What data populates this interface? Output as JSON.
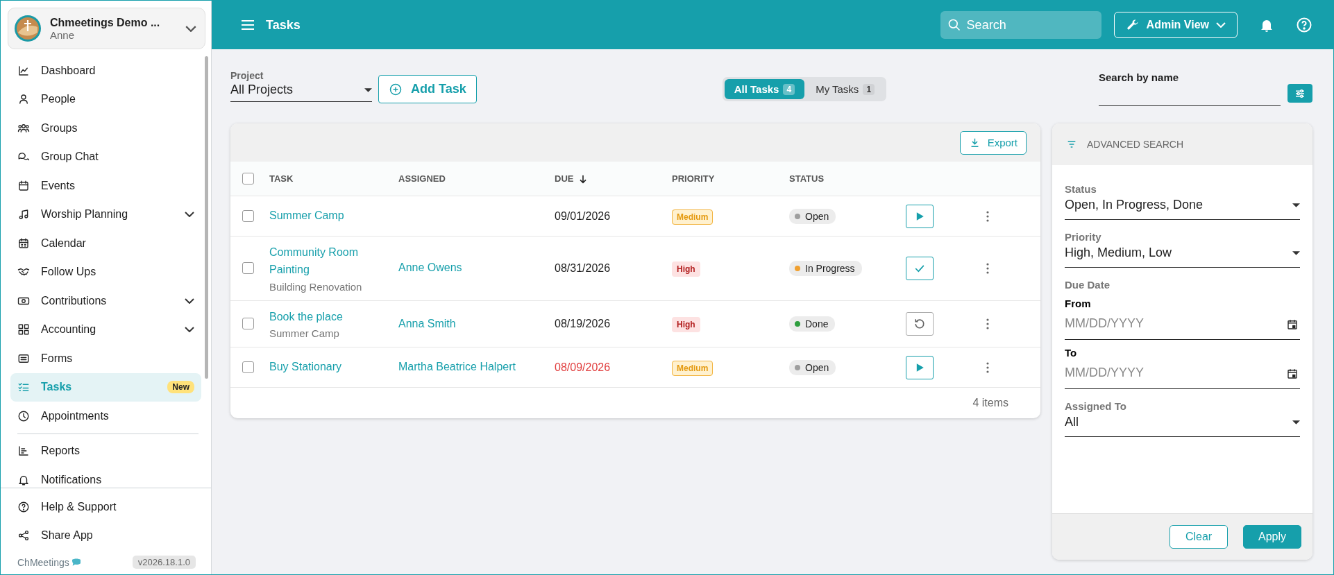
{
  "sidebar": {
    "account": {
      "name": "Chmeetings Demo ...",
      "user": "Anne"
    },
    "nav_sections": [
      {
        "items": [
          {
            "label": "Dashboard",
            "selected": false,
            "expandable": false
          },
          {
            "label": "People",
            "selected": false,
            "expandable": false
          },
          {
            "label": "Groups",
            "selected": false,
            "expandable": false
          },
          {
            "label": "Group Chat",
            "selected": false,
            "expandable": false
          },
          {
            "label": "Events",
            "selected": false,
            "expandable": false
          },
          {
            "label": "Worship Planning",
            "selected": false,
            "expandable": true
          },
          {
            "label": "Calendar",
            "selected": false,
            "expandable": false
          },
          {
            "label": "Follow Ups",
            "selected": false,
            "expandable": false
          },
          {
            "label": "Contributions",
            "selected": false,
            "expandable": true
          },
          {
            "label": "Accounting",
            "selected": false,
            "expandable": true
          },
          {
            "label": "Forms",
            "selected": false,
            "expandable": false
          },
          {
            "label": "Tasks",
            "selected": true,
            "expandable": false,
            "badge": "New"
          },
          {
            "label": "Appointments",
            "selected": false,
            "expandable": false
          }
        ]
      },
      {
        "items": [
          {
            "label": "Reports",
            "selected": false,
            "expandable": false
          },
          {
            "label": "Notifications",
            "selected": false,
            "expandable": false
          }
        ]
      }
    ],
    "bottom_items": [
      {
        "label": "Help & Support"
      },
      {
        "label": "Share App"
      }
    ],
    "brand": "ChMeetings",
    "version": "v2026.18.1.0"
  },
  "header": {
    "title": "Tasks",
    "search": {
      "placeholder": "Search"
    },
    "view_button": "Admin View"
  },
  "toolbar": {
    "project": {
      "label": "Project",
      "value": "All Projects"
    },
    "add_button": "Add Task",
    "tabs": [
      {
        "label": "All Tasks",
        "count": "4",
        "selected": true
      },
      {
        "label": "My Tasks",
        "count": "1",
        "selected": false
      }
    ],
    "name_search": {
      "label": "Search by name"
    }
  },
  "table": {
    "export_button": "Export",
    "select_all": {
      "checked": false
    },
    "columns": [
      {
        "label": "TASK",
        "sorted": false
      },
      {
        "label": "ASSIGNED",
        "sorted": false
      },
      {
        "label": "DUE",
        "sorted": true
      },
      {
        "label": "PRIORITY",
        "sorted": false
      },
      {
        "label": "STATUS",
        "sorted": false
      }
    ],
    "rows": [
      {
        "checked": false,
        "task": "Summer Camp",
        "due": "09/01/2026",
        "overdue": false,
        "priority": {
          "label": "Medium",
          "kind": "medium"
        },
        "status": {
          "label": "Open",
          "color": "#9e9e9e"
        },
        "action": {
          "kind": "start"
        }
      },
      {
        "checked": false,
        "task": "Community Room Painting",
        "project": "Building Renovation",
        "assigned": "Anne Owens",
        "due": "08/31/2026",
        "overdue": false,
        "priority": {
          "label": "High",
          "kind": "high"
        },
        "status": {
          "label": "In Progress",
          "color": "#f0a030"
        },
        "action": {
          "kind": "complete"
        }
      },
      {
        "checked": false,
        "task": "Book the place",
        "project": "Summer Camp",
        "assigned": "Anna Smith",
        "due": "08/19/2026",
        "overdue": false,
        "priority": {
          "label": "High",
          "kind": "high"
        },
        "status": {
          "label": "Done",
          "color": "#2e9e3e"
        },
        "action": {
          "kind": "reopen"
        }
      },
      {
        "checked": false,
        "task": "Buy Stationary",
        "assigned": "Martha Beatrice Halpert",
        "due": "08/09/2026",
        "overdue": true,
        "priority": {
          "label": "Medium",
          "kind": "medium"
        },
        "status": {
          "label": "Open",
          "color": "#9e9e9e"
        },
        "action": {
          "kind": "start"
        }
      }
    ],
    "footer": "4 items"
  },
  "advanced_search": {
    "title": "ADVANCED SEARCH",
    "fields": [
      {
        "kind": "select",
        "label": "Status",
        "value": "Open, In Progress, Done"
      },
      {
        "kind": "select",
        "label": "Priority",
        "value": "High, Medium, Low"
      },
      {
        "kind": "dates",
        "label": "Due Date",
        "ranges": [
          {
            "label": "From",
            "placeholder": "MM/DD/YYYY"
          },
          {
            "label": "To",
            "placeholder": "MM/DD/YYYY"
          }
        ]
      },
      {
        "kind": "select",
        "label": "Assigned To",
        "value": "All"
      }
    ],
    "buttons": [
      {
        "label": "Clear",
        "kind": "secondary"
      },
      {
        "label": "Apply",
        "kind": "primary"
      }
    ]
  }
}
